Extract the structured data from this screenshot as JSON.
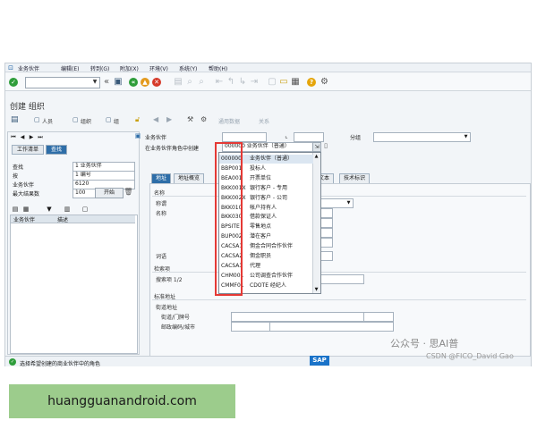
{
  "menu": [
    "业务伙伴",
    "编辑(E)",
    "转到(G)",
    "附加(X)",
    "环境(V)",
    "系统(Y)",
    "帮助(H)"
  ],
  "page_title": "创建 组织",
  "app_toolbar": {
    "person": "人员",
    "org": "组织",
    "group": "组",
    "general_data": "通用数据",
    "relation": "关系"
  },
  "left": {
    "tab_worklist": "工作清单",
    "tab_find": "查找",
    "find_label": "查找",
    "find_value": "1 业务伙伴",
    "by_label": "按",
    "by_value": "1 编号",
    "bp_label": "业务伙伴",
    "bp_value": "6120",
    "max_label": "最大结果数",
    "max_value": "100",
    "start_btn": "开始",
    "col_bp": "业务伙伴",
    "col_desc": "描述"
  },
  "header": {
    "bp_label": "业务伙伴",
    "role_label": "在业务伙伴角色中创建",
    "role_value": "000000 业务伙伴（普通）",
    "group_label": "分组"
  },
  "tabs": [
    "地址",
    "地址概览",
    "文本",
    "技术标识"
  ],
  "form": {
    "name_section": "名称",
    "title_label": "称谓",
    "name_label": "名称",
    "terms_label": "词语",
    "search_section": "检索项",
    "search_label": "搜索项 1/2",
    "std_addr": "标准地址",
    "street_section": "街道地址",
    "street_label": "街道/门牌号",
    "postal_label": "邮政编码/城市"
  },
  "dropdown": [
    {
      "code": "000000",
      "desc": "业务伙伴（普通）"
    },
    {
      "code": "BBP001",
      "desc": "投标人"
    },
    {
      "code": "BEA001",
      "desc": "开票单位"
    },
    {
      "code": "BKK001X",
      "desc": "银行客户 - 专用"
    },
    {
      "code": "BKK002X",
      "desc": "银行客户 - 公司"
    },
    {
      "code": "BKK010",
      "desc": "帐户持有人"
    },
    {
      "code": "BKK030",
      "desc": "借款保证人"
    },
    {
      "code": "BPSITE",
      "desc": "零售地点"
    },
    {
      "code": "BUP002",
      "desc": "潜在客户"
    },
    {
      "code": "CACSA1",
      "desc": "佣金合同合作伙伴"
    },
    {
      "code": "CACSA2",
      "desc": "佣金职员"
    },
    {
      "code": "CACSA3",
      "desc": "代理"
    },
    {
      "code": "CHM001",
      "desc": "公司调查合作伙伴"
    },
    {
      "code": "CMMF01",
      "desc": "CDOTE 经纪人"
    }
  ],
  "status_text": "选择希望创建的商业伙伴中的角色",
  "sap_logo": "SAP",
  "watermark": {
    "line1": "公众号 · 思AI普",
    "line2": "CSDN @FICO_David Gao"
  },
  "banner": "huangguanandroid.com"
}
